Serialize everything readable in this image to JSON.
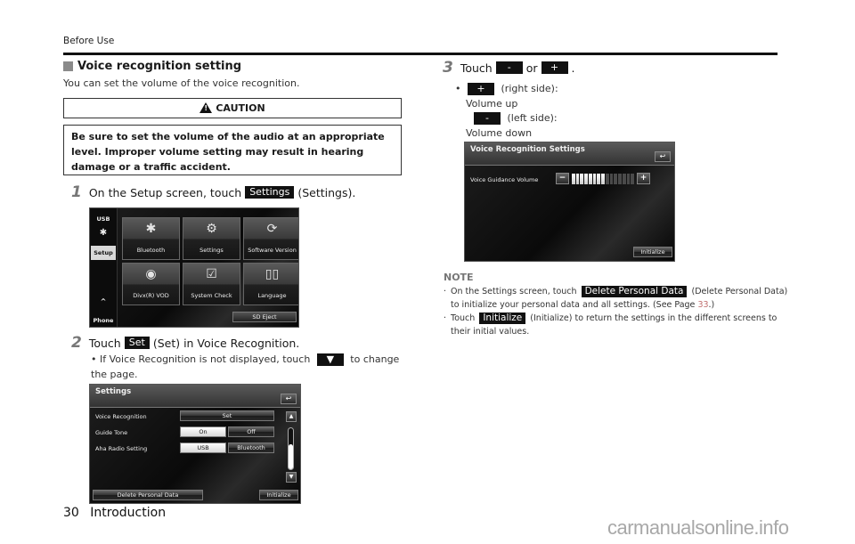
{
  "header": {
    "running_head": "Before Use"
  },
  "section": {
    "title": "Voice recognition setting",
    "intro": "You can set the volume of the voice recognition."
  },
  "caution": {
    "label": "CAUTION",
    "text": "Be sure to set the volume of the audio at an appropriate level. Improper volume setting may result in hearing damage or a traffic accident."
  },
  "steps": [
    {
      "number": "1",
      "prefix": "On the Setup screen, touch",
      "chip": "Settings",
      "suffix": "(Settings)."
    },
    {
      "number": "2",
      "prefix": "Touch",
      "chip": "Set",
      "suffix": "(Set) in Voice Recognition.",
      "bullet_prefix": "If Voice Recognition is not displayed, touch",
      "bullet_suffix": "to change the page."
    },
    {
      "number": "3",
      "prefix": "Touch",
      "chip_minus": "-",
      "or": "or",
      "chip_plus": "+",
      "suffix": ".",
      "plus_desc": "(right side):",
      "plus_result": "Volume up",
      "minus_desc": "(left side):",
      "minus_result": "Volume down"
    }
  ],
  "setup_screen": {
    "sidebar": [
      {
        "label": "USB",
        "active": false
      },
      {
        "label": "",
        "icon": "bluetooth-icon",
        "active": false
      },
      {
        "label": "Setup",
        "active": true
      },
      {
        "label": "^",
        "active": false
      },
      {
        "label": "Phone",
        "active": false
      }
    ],
    "tiles": [
      {
        "label": "Bluetooth",
        "icon": "bluetooth-icon"
      },
      {
        "label": "Settings",
        "icon": "wrench-gear-icon"
      },
      {
        "label": "Software Version",
        "icon": "refresh-icon"
      },
      {
        "label": "Divx(R) VOD",
        "icon": "disc-icon"
      },
      {
        "label": "System Check",
        "icon": "checklist-icon"
      },
      {
        "label": "Language",
        "icon": "book-icon"
      }
    ],
    "sd_eject": "SD Eject"
  },
  "settings_screen": {
    "title": "Settings",
    "rows": [
      {
        "label": "Voice Recognition",
        "options": [
          "Set"
        ]
      },
      {
        "label": "Guide Tone",
        "options": [
          "On",
          "Off"
        ],
        "selected": "On"
      },
      {
        "label": "Aha Radio Setting",
        "options": [
          "USB",
          "Bluetooth"
        ],
        "selected": "USB"
      }
    ],
    "delete_btn": "Delete Personal Data",
    "initialize_btn": "Initialize",
    "scroll_position": 0.6
  },
  "vr_screen": {
    "title": "Voice Recognition Settings",
    "volume_label": "Voice Guidance Volume",
    "volume_level": 8,
    "volume_max": 15,
    "initialize_btn": "Initialize"
  },
  "note": {
    "title": "NOTE",
    "items": [
      {
        "prefix": "On the Settings screen, touch",
        "chip": "Delete Personal Data",
        "middle": "(Delete Personal Data) to initialize your personal data and all settings. (See Page",
        "page": "33",
        "suffix": ".)"
      },
      {
        "prefix": "Touch",
        "chip": "Initialize",
        "suffix": "(Initialize) to return the settings in the different screens to their initial values."
      }
    ]
  },
  "footer": {
    "page_number": "30",
    "section": "Introduction"
  },
  "watermark": "carmanualsonline.info"
}
